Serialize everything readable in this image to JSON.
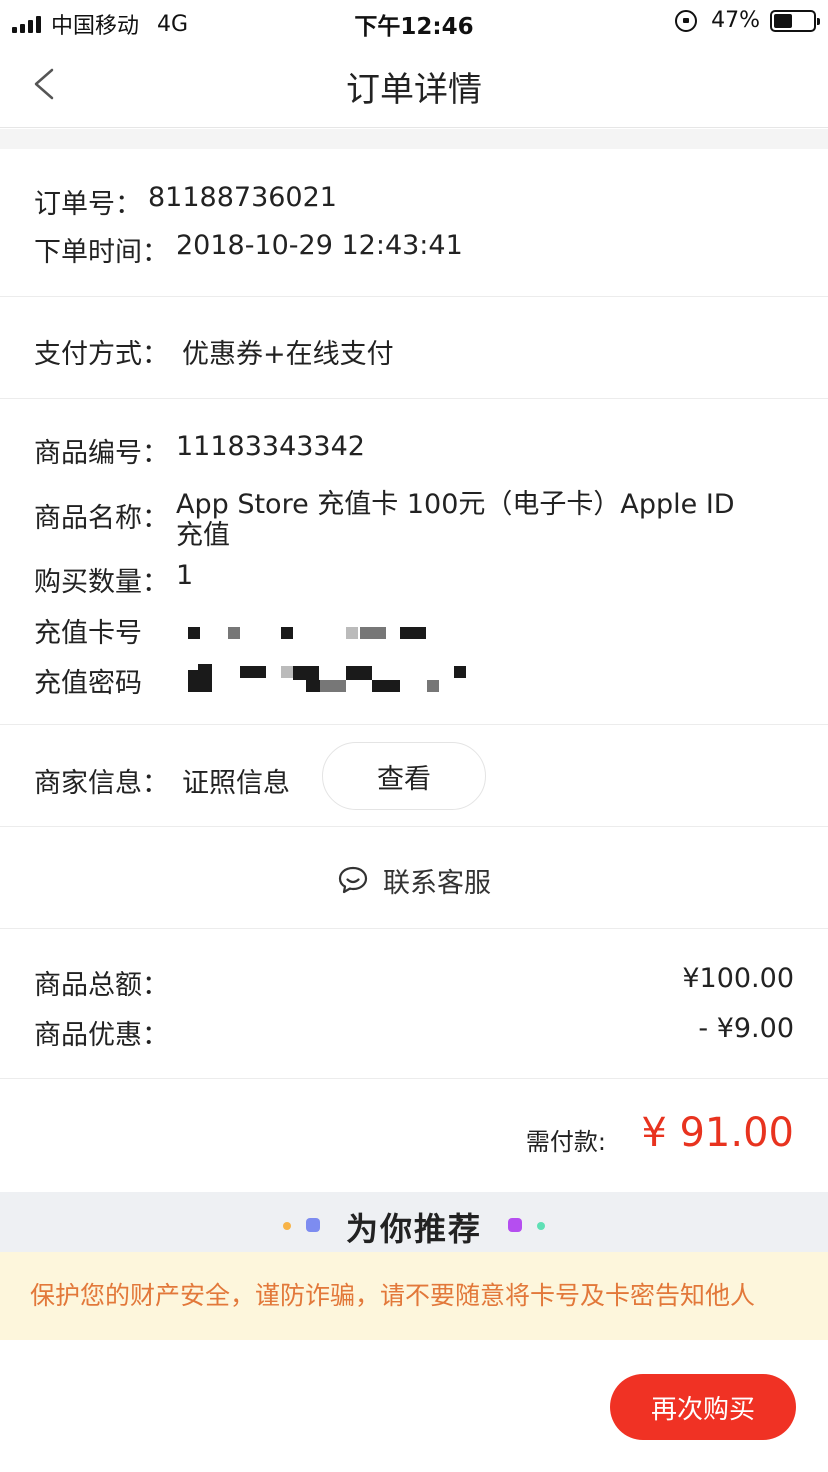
{
  "status_bar": {
    "carrier": "中国移动",
    "network": "4G",
    "time": "下午12:46",
    "battery": "47%",
    "battery_level": 0.47
  },
  "nav": {
    "title": "订单详情",
    "back_icon": "chevron-left-icon"
  },
  "order": {
    "order_no_label": "订单号：",
    "order_no": "81188736021",
    "order_time_label": "下单时间：",
    "order_time": "2018-10-29 12:43:41"
  },
  "payment": {
    "label": "支付方式：",
    "value": "优惠券+在线支付"
  },
  "product": {
    "id_label": "商品编号：",
    "id": "11183343342",
    "name_label": "商品名称：",
    "name_line1": "App Store 充值卡 100元（电子卡）Apple ID",
    "name_line2": "充值",
    "qty_label": "购买数量：",
    "qty": "1",
    "card_no_label": "充值卡号",
    "card_pwd_label": "充值密码"
  },
  "merchant": {
    "label": "商家信息：",
    "value": "证照信息",
    "view_button": "查看"
  },
  "contact": {
    "label": "联系客服",
    "icon": "chat-bubble-icon"
  },
  "totals": {
    "subtotal_label": "商品总额：",
    "subtotal": "¥100.00",
    "discount_label": "商品优惠：",
    "discount": "- ¥9.00",
    "need_pay_label": "需付款:",
    "need_pay": "¥ 91.00"
  },
  "recommend": {
    "title": "为你推荐"
  },
  "warning": {
    "text": "保护您的财产安全，谨防诈骗，请不要随意将卡号及卡密告知他人"
  },
  "actions": {
    "buy_again": "再次购买"
  },
  "colors": {
    "accent_red": "#f03224",
    "price_red": "#e8331f",
    "warning_text": "#e2783a",
    "warning_bg": "#fdf6dc"
  }
}
